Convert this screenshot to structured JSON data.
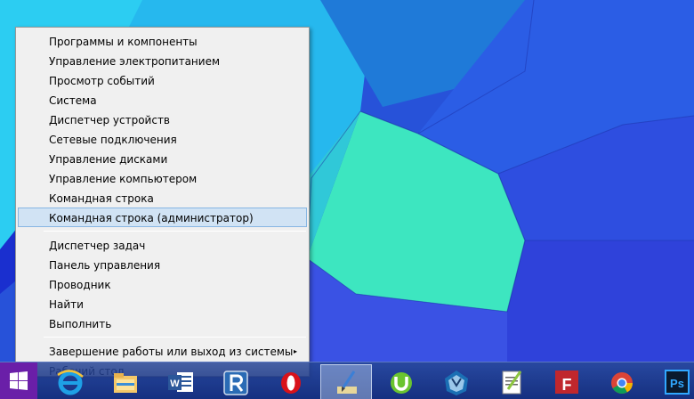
{
  "menu": {
    "groups": [
      [
        {
          "label": "Программы и компоненты"
        },
        {
          "label": "Управление электропитанием"
        },
        {
          "label": "Просмотр событий"
        },
        {
          "label": "Система"
        },
        {
          "label": "Диспетчер устройств"
        },
        {
          "label": "Сетевые подключения"
        },
        {
          "label": "Управление дисками"
        },
        {
          "label": "Управление компьютером"
        },
        {
          "label": "Командная строка"
        },
        {
          "label": "Командная строка (администратор)",
          "highlighted": true
        }
      ],
      [
        {
          "label": "Диспетчер задач"
        },
        {
          "label": "Панель управления"
        },
        {
          "label": "Проводник"
        },
        {
          "label": "Найти"
        },
        {
          "label": "Выполнить"
        }
      ],
      [
        {
          "label": "Завершение работы или выход из системы",
          "submenu_arrow": "▸"
        },
        {
          "label": "Рабочий стол"
        }
      ]
    ]
  },
  "taskbar": {
    "start_icon": "windows-logo-icon",
    "pinned": [
      {
        "name": "internet-explorer",
        "icon": "internet-explorer-icon",
        "active": false
      },
      {
        "name": "file-explorer",
        "icon": "folder-icon",
        "active": false
      },
      {
        "name": "word",
        "icon": "word-icon",
        "active": false
      },
      {
        "name": "r-studio",
        "icon": "r-icon",
        "active": false
      },
      {
        "name": "opera",
        "icon": "opera-icon",
        "active": false
      },
      {
        "name": "paint",
        "icon": "paint-brush-icon",
        "active": true
      },
      {
        "name": "utorrent",
        "icon": "utorrent-icon",
        "active": false
      },
      {
        "name": "virtualbox",
        "icon": "virtualbox-icon",
        "active": false
      },
      {
        "name": "notepad-plus-plus",
        "icon": "notepad-plus-plus-icon",
        "active": false
      },
      {
        "name": "filezilla",
        "icon": "filezilla-icon",
        "active": false
      },
      {
        "name": "chrome",
        "icon": "chrome-icon",
        "active": false
      },
      {
        "name": "photoshop",
        "icon": "photoshop-icon",
        "active": false
      }
    ]
  },
  "colors": {
    "menu_background": "#f0f0f0",
    "menu_highlight": "#d1e3f4",
    "menu_highlight_border": "#87b6e3",
    "start_button": "#6a1fa8"
  }
}
